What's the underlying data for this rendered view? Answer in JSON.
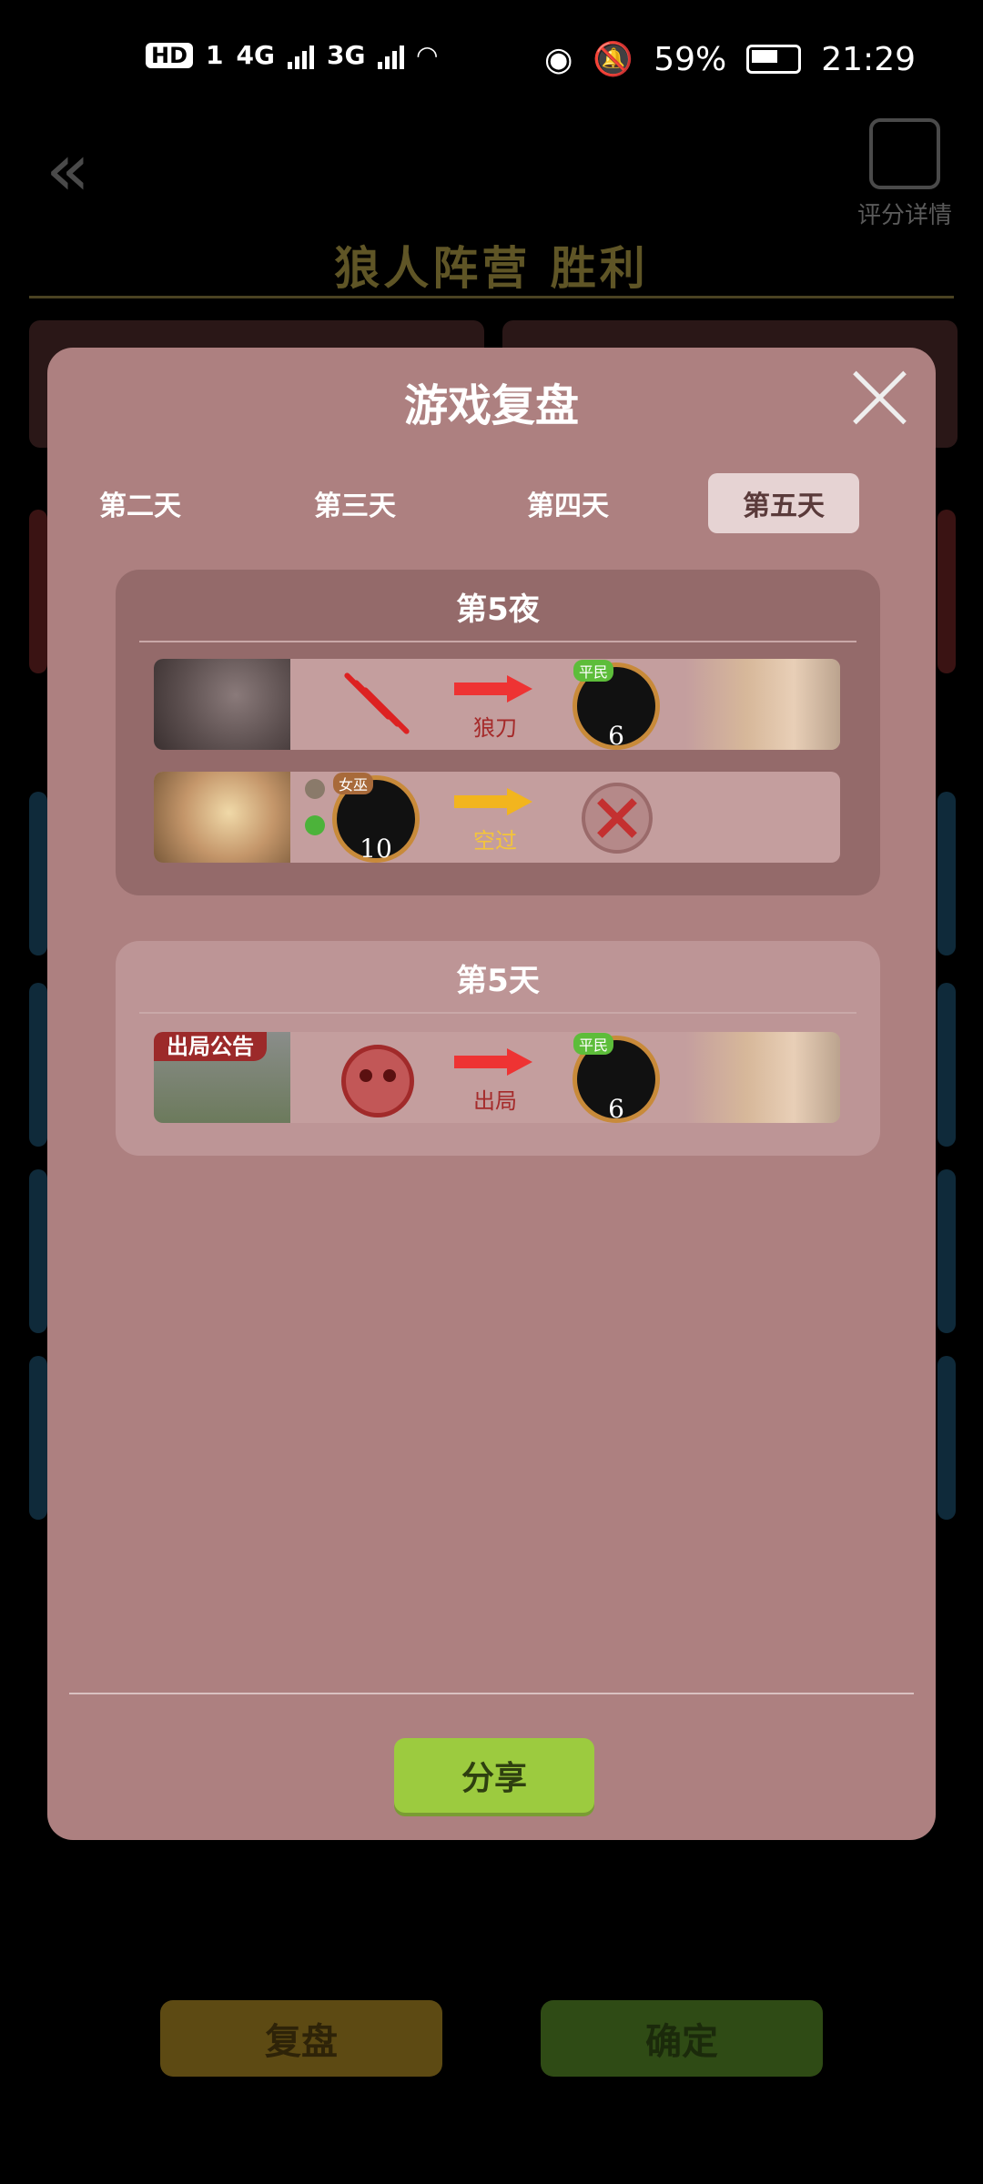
{
  "status_bar": {
    "network_hd": "HD",
    "sim_slot": "1",
    "net_1": "4G",
    "net_2": "3G",
    "battery_percent": "59%",
    "time": "21:29"
  },
  "background": {
    "back_icon": "double-chevron-left-icon",
    "detail_label": "评分详情",
    "result_title": "狼人阵营  胜利",
    "replay_button": "复盘",
    "confirm_button": "确定",
    "accent_gold": "#5f5526"
  },
  "modal": {
    "title": "游戏复盘",
    "close_icon": "close-icon",
    "tabs": [
      {
        "label": "第二天"
      },
      {
        "label": "第三天"
      },
      {
        "label": "第四天"
      },
      {
        "label": "第五天",
        "active": true
      }
    ],
    "night": {
      "title": "第5夜",
      "rows": [
        {
          "actor": "wolf-portrait",
          "action_icon": "claw-icon",
          "action_label": "狼刀",
          "target_role": "平民",
          "target_number": "6"
        },
        {
          "actor": "witch-portrait",
          "actor_role": "女巫",
          "actor_number": "10",
          "action_label": "空过",
          "result_icon": "cross-icon"
        }
      ]
    },
    "day": {
      "title": "第5天",
      "rows": [
        {
          "banner": "出局公告",
          "action_icon": "skull-icon",
          "action_label": "出局",
          "target_role": "平民",
          "target_number": "6"
        }
      ]
    },
    "share_button": "分享",
    "colors": {
      "modal_bg": "#ad8080",
      "share_green": "#9ccb3f",
      "arrow_red": "#e33333",
      "arrow_yellow": "#f2b51e"
    }
  }
}
